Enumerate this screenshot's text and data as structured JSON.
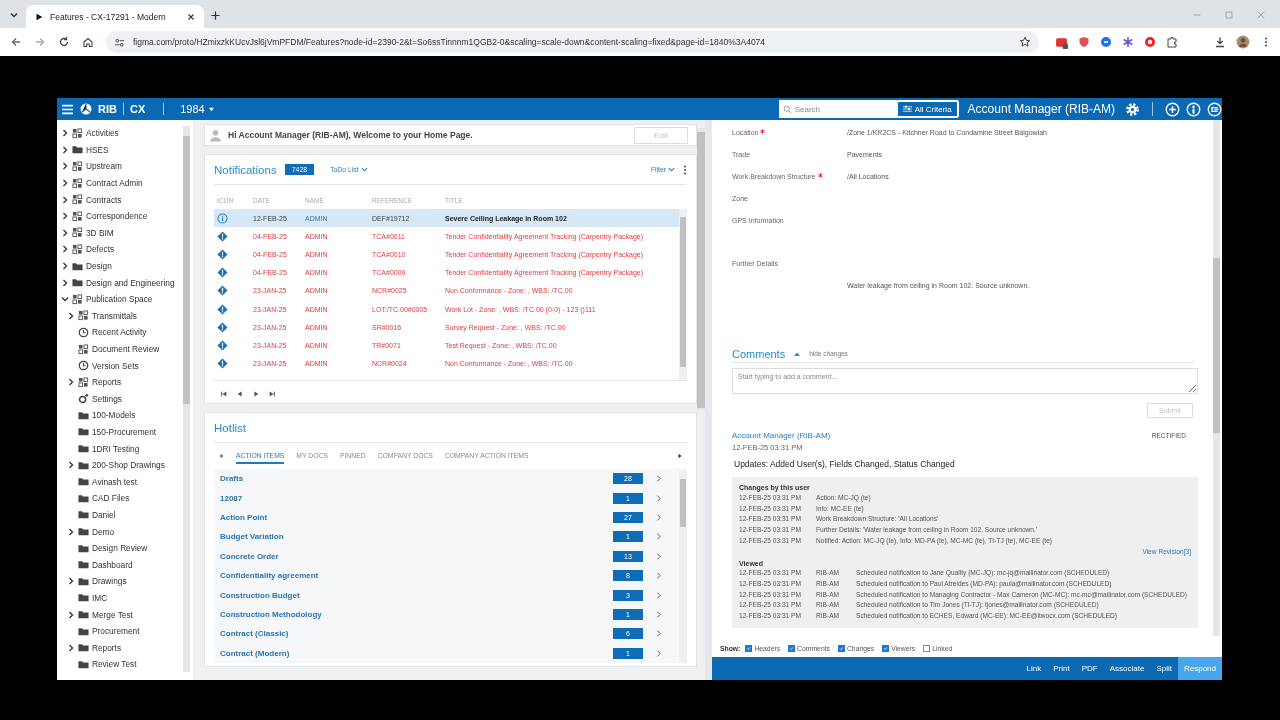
{
  "browser": {
    "tab_title": "Features - CX-17291 - Modern",
    "url": "figma.com/proto/HZmixzkKUcvJsl6jVmPFDM/Features?node-id=2390-2&t=So6ssTinnnm1QGB2-0&scaling=scale-down&content-scaling=fixed&page-id=1840%3A4074"
  },
  "header": {
    "brand": "RIB",
    "product": "CX",
    "project": "1984",
    "search": {
      "placeholder": "Search"
    },
    "criteria_button": "All Criteria",
    "user": "Account Manager (RIB-AM)"
  },
  "sidebar": {
    "items": [
      {
        "label": "Activities",
        "kind": "module",
        "expanded": false
      },
      {
        "label": "HSES",
        "kind": "folder",
        "expanded": false
      },
      {
        "label": "Upstream",
        "kind": "module",
        "expanded": false
      },
      {
        "label": "Contract Admin",
        "kind": "module",
        "expanded": false
      },
      {
        "label": "Contracts",
        "kind": "module",
        "expanded": false
      },
      {
        "label": "Correspondence",
        "kind": "module",
        "expanded": false
      },
      {
        "label": "3D BIM",
        "kind": "module",
        "expanded": false
      },
      {
        "label": "Defects",
        "kind": "module",
        "expanded": false
      },
      {
        "label": "Design",
        "kind": "folder",
        "expanded": false
      },
      {
        "label": "Design and Engineering",
        "kind": "folder",
        "expanded": false
      },
      {
        "label": "Publication Space",
        "kind": "module",
        "expanded": true,
        "children": [
          {
            "label": "Transmittals",
            "kind": "module",
            "expanded": false
          },
          {
            "label": "Recent Activity",
            "kind": "clock"
          },
          {
            "label": "Document Review",
            "kind": "module"
          },
          {
            "label": "Version Sets",
            "kind": "clock"
          },
          {
            "label": "Reports",
            "kind": "module",
            "expanded": false
          },
          {
            "label": "Settings",
            "kind": "gear"
          },
          {
            "label": "100-Models",
            "kind": "folder"
          },
          {
            "label": "150-Procurement",
            "kind": "folder"
          },
          {
            "label": "1DRI Testing",
            "kind": "folder"
          },
          {
            "label": "200-Shop Drawings",
            "kind": "folder",
            "expanded": false
          },
          {
            "label": "Avinash test",
            "kind": "folder"
          },
          {
            "label": "CAD Files",
            "kind": "folder"
          },
          {
            "label": "Daniel",
            "kind": "folder"
          },
          {
            "label": "Demo",
            "kind": "folder",
            "expanded": false
          },
          {
            "label": "Design Review",
            "kind": "folder"
          },
          {
            "label": "Dashboard",
            "kind": "folder"
          },
          {
            "label": "Drawings",
            "kind": "folder",
            "expanded": false
          },
          {
            "label": "IMC",
            "kind": "folder"
          },
          {
            "label": "Merge Test",
            "kind": "folder",
            "expanded": false
          },
          {
            "label": "Procurement",
            "kind": "folder"
          },
          {
            "label": "Reports",
            "kind": "folder",
            "expanded": false
          },
          {
            "label": "Review Test",
            "kind": "folder"
          }
        ]
      }
    ]
  },
  "welcome": {
    "message": "Hi Account Manager (RIB-AM), Welcome to your Home Page.",
    "edit_button": {
      "label": "Edit",
      "disabled": true
    }
  },
  "notifications": {
    "title": "Notifications",
    "count": "7428",
    "view": "ToDo List",
    "filter": "Filter",
    "columns": [
      "ICON",
      "DATE",
      "NAME",
      "REFERENCE",
      "TITLE"
    ],
    "rows": [
      {
        "kind": "info",
        "date": "12-FEB-25",
        "name": "ADMIN",
        "reference": "DEF#19712",
        "title": "Severe Ceiling Leakage in Room 102",
        "selected": true,
        "overdue": false
      },
      {
        "kind": "action",
        "date": "04-FEB-25",
        "name": "ADMIN",
        "reference": "TCA#0011",
        "title": "Tender Confidentiality Agreement Tracking (Carpentry Package)",
        "selected": false,
        "overdue": true
      },
      {
        "kind": "action",
        "date": "04-FEB-25",
        "name": "ADMIN",
        "reference": "TCA#0010",
        "title": "Tender Confidentiality Agreement Tracking (Carpentry Package)",
        "selected": false,
        "overdue": true
      },
      {
        "kind": "action",
        "date": "04-FEB-25",
        "name": "ADMIN",
        "reference": "TCA#0009",
        "title": "Tender Confidentiality Agreement Tracking (Carpentry Package)",
        "selected": false,
        "overdue": true
      },
      {
        "kind": "action",
        "date": "23-JAN-25",
        "name": "ADMIN",
        "reference": "NCR#0025",
        "title": "Non Conformance - Zone: , WBS: /TC.00",
        "selected": false,
        "overdue": true
      },
      {
        "kind": "action",
        "date": "23-JAN-25",
        "name": "ADMIN",
        "reference": "LOT:/TC.00#0005",
        "title": "Work Lot - Zone: , WBS: /TC.00 (0-0) - 123 ()111",
        "selected": false,
        "overdue": true
      },
      {
        "kind": "action",
        "date": "23-JAN-25",
        "name": "ADMIN",
        "reference": "SR#0016",
        "title": "Survey Request - Zone: , WBS: /TC.00",
        "selected": false,
        "overdue": true
      },
      {
        "kind": "action",
        "date": "23-JAN-25",
        "name": "ADMIN",
        "reference": "TR#0071",
        "title": "Test Request - Zone: , WBS: /TC.00",
        "selected": false,
        "overdue": true
      },
      {
        "kind": "action",
        "date": "23-JAN-25",
        "name": "ADMIN",
        "reference": "NCR#0024",
        "title": "Non Conformance - Zone: , WBS: /TC.00",
        "selected": false,
        "overdue": true
      }
    ]
  },
  "hotlist": {
    "title": "Hotlist",
    "tabs": [
      {
        "label": "ACTION ITEMS",
        "selected": true
      },
      {
        "label": "MY DOCS",
        "selected": false
      },
      {
        "label": "PINNED",
        "selected": false
      },
      {
        "label": "COMPANY DOCS",
        "selected": false
      },
      {
        "label": "COMPANY ACTION ITEMS",
        "selected": false
      }
    ],
    "items": [
      {
        "label": "Drafts",
        "count": "28"
      },
      {
        "label": "12087",
        "count": "1"
      },
      {
        "label": "Action Point",
        "count": "27"
      },
      {
        "label": "Budget Variation",
        "count": "1"
      },
      {
        "label": "Concrete Order",
        "count": "13"
      },
      {
        "label": "Confidentiality agreement",
        "count": "8"
      },
      {
        "label": "Construction Budget",
        "count": "3"
      },
      {
        "label": "Construction Methodology",
        "count": "1"
      },
      {
        "label": "Contract (Classic)",
        "count": "6"
      },
      {
        "label": "Contract (Modern)",
        "count": "1"
      }
    ]
  },
  "detail": {
    "fields": [
      {
        "label": "Location",
        "required": true,
        "kind": "inline",
        "value": "/Zone 1/KR2CS - Kitchner Road to Condamine Street Balgowlah"
      },
      {
        "label": "Trade",
        "required": false,
        "kind": "inline",
        "value": "Pavements"
      },
      {
        "label": "Work Breakdown Structure",
        "required": true,
        "kind": "inline",
        "value": "/All Locations"
      },
      {
        "label": "Zone",
        "required": false,
        "kind": "inline"
      },
      {
        "label": "GPS Information",
        "required": false,
        "kind": "area"
      },
      {
        "label": "Further Details",
        "required": false,
        "kind": "block",
        "value": "Water leakage from ceiling in Room 102. Source unknown."
      }
    ],
    "comments": {
      "title": "Comments",
      "toggle": "hide changes",
      "placeholder": "Start typing to add a comment...",
      "submit": {
        "label": "Submit",
        "disabled": true
      },
      "entry": {
        "author": "Account Manager (RIB-AM)",
        "time": "12-FEB-25 03:31 PM",
        "status": "RECTIFIED",
        "summary": "Updates: Added User(s), Fields Changed, Status Changed",
        "changes_heading": "Changes by this user",
        "changes": [
          {
            "time": "12-FEB-25 03:31 PM",
            "text": "Action: MC-JQ (te)"
          },
          {
            "time": "12-FEB-25 03:31 PM",
            "text": "Info: MC-EE (te)"
          },
          {
            "time": "12-FEB-25 03:31 PM",
            "text": "Work Breakdown Structure: 'All Locations'"
          },
          {
            "time": "12-FEB-25 03:31 PM",
            "text": "Further Details: 'Water leakage from ceiling in Room 102. Source unknown.'"
          },
          {
            "time": "12-FEB-25 03:31 PM",
            "text": "Notified: Action: MC-JQ (te), Info: MD-PA (te), MC-MC (te), TI-TJ (te), MC-EE (te)"
          }
        ],
        "revision_link": "View Revision[3]",
        "viewed_heading": "Viewed",
        "viewed": [
          {
            "time": "12-FEB-25 03:31 PM",
            "user": "RIB-AM",
            "text": "Scheduled notification to Jane Quality (MC-JQ): mc-jq@mailinator.com (SCHEDULED)"
          },
          {
            "time": "12-FEB-25 03:31 PM",
            "user": "RIB-AM",
            "text": "Scheduled notification to Paul Atreides (MD-PA): paula@mailinator.com (SCHEDULED)"
          },
          {
            "time": "12-FEB-25 03:31 PM",
            "user": "RIB-AM",
            "text": "Scheduled notification to Managing Contractor - Max Cameron (MC-MC): mc-mc@mailinator.com (SCHEDULED)"
          },
          {
            "time": "12-FEB-25 03:31 PM",
            "user": "RIB-AM",
            "text": "Scheduled notification to Tim Jones (TI-TJ): tjones@mailinator.com (SCHEDULED)"
          },
          {
            "time": "12-FEB-25 03:31 PM",
            "user": "RIB-AM",
            "text": "Scheduled notification to ECHES, Edward (MC-EE): MC-EE@itwocx.com (SCHEDULED)"
          }
        ]
      }
    }
  },
  "show": {
    "label": "Show:",
    "options": [
      {
        "label": "Headers",
        "checked": true
      },
      {
        "label": "Comments",
        "checked": true
      },
      {
        "label": "Changes",
        "checked": true
      },
      {
        "label": "Viewers",
        "checked": true
      },
      {
        "label": "Linked",
        "checked": false
      }
    ]
  },
  "actions": [
    {
      "label": "Link",
      "selected": false
    },
    {
      "label": "Print",
      "selected": false
    },
    {
      "label": "PDF",
      "selected": false
    },
    {
      "label": "Associate",
      "selected": false
    },
    {
      "label": "Split",
      "selected": false
    },
    {
      "label": "Respond",
      "selected": true
    }
  ]
}
